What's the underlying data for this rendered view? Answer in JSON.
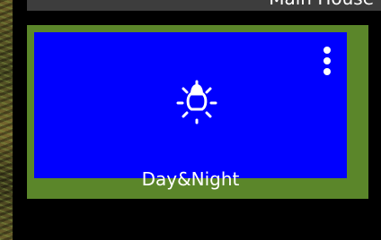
{
  "header": {
    "title": "Main House"
  },
  "card": {
    "label": "Day&Night",
    "icon": "lightbulb-icon",
    "menu_icon": "more-vertical-icon",
    "colors": {
      "card_background": "#5b862a",
      "preview_background": "#0000ff",
      "foreground": "#ffffff",
      "top_bar": "#3d3d3d"
    }
  }
}
